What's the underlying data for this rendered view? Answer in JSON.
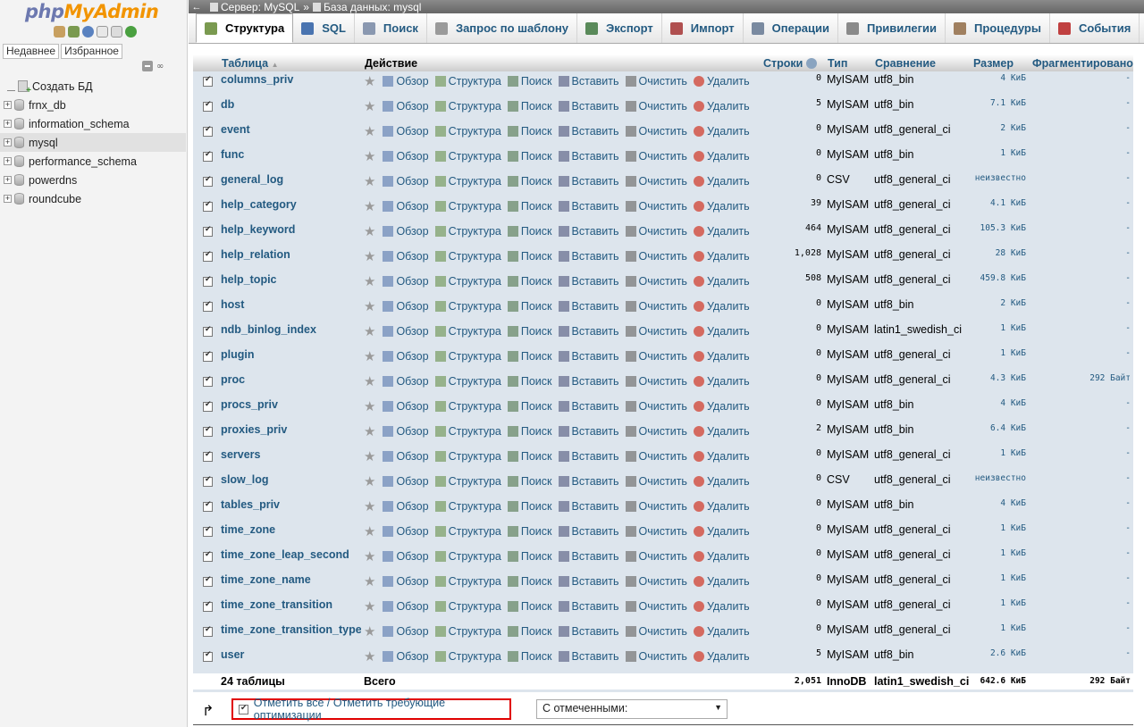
{
  "logo": {
    "php": "php",
    "myadmin": "MyAdmin"
  },
  "nav_tabs": [
    "Недавнее",
    "Избранное"
  ],
  "databases": [
    {
      "name": "Создать БД",
      "type": "new"
    },
    {
      "name": "frnx_db",
      "type": "db"
    },
    {
      "name": "information_schema",
      "type": "db"
    },
    {
      "name": "mysql",
      "type": "db",
      "active": true
    },
    {
      "name": "performance_schema",
      "type": "db"
    },
    {
      "name": "powerdns",
      "type": "db"
    },
    {
      "name": "roundcube",
      "type": "db"
    }
  ],
  "breadcrumb": {
    "server": "Сервер: MySQL",
    "sep": "»",
    "database": "База данных: mysql"
  },
  "tabs": [
    "Структура",
    "SQL",
    "Поиск",
    "Запрос по шаблону",
    "Экспорт",
    "Импорт",
    "Операции",
    "Привилегии",
    "Процедуры",
    "События",
    "Тр"
  ],
  "columns": {
    "table": "Таблица",
    "action": "Действие",
    "rows": "Строки",
    "type": "Тип",
    "collation": "Сравнение",
    "size": "Размер",
    "overhead": "Фрагментировано"
  },
  "action_labels": {
    "browse": "Обзор",
    "structure": "Структура",
    "search": "Поиск",
    "insert": "Вставить",
    "empty": "Очистить",
    "drop": "Удалить"
  },
  "tables": [
    {
      "name": "columns_priv",
      "rows": "0",
      "type": "MyISAM",
      "collation": "utf8_bin",
      "size": "4 КиБ",
      "overhead": "-"
    },
    {
      "name": "db",
      "rows": "5",
      "type": "MyISAM",
      "collation": "utf8_bin",
      "size": "7.1 КиБ",
      "overhead": "-"
    },
    {
      "name": "event",
      "rows": "0",
      "type": "MyISAM",
      "collation": "utf8_general_ci",
      "size": "2 КиБ",
      "overhead": "-"
    },
    {
      "name": "func",
      "rows": "0",
      "type": "MyISAM",
      "collation": "utf8_bin",
      "size": "1 КиБ",
      "overhead": "-"
    },
    {
      "name": "general_log",
      "rows": "0",
      "type": "CSV",
      "collation": "utf8_general_ci",
      "size": "неизвестно",
      "overhead": "-"
    },
    {
      "name": "help_category",
      "rows": "39",
      "type": "MyISAM",
      "collation": "utf8_general_ci",
      "size": "4.1 КиБ",
      "overhead": "-"
    },
    {
      "name": "help_keyword",
      "rows": "464",
      "type": "MyISAM",
      "collation": "utf8_general_ci",
      "size": "105.3 КиБ",
      "overhead": "-"
    },
    {
      "name": "help_relation",
      "rows": "1,028",
      "type": "MyISAM",
      "collation": "utf8_general_ci",
      "size": "28 КиБ",
      "overhead": "-"
    },
    {
      "name": "help_topic",
      "rows": "508",
      "type": "MyISAM",
      "collation": "utf8_general_ci",
      "size": "459.8 КиБ",
      "overhead": "-"
    },
    {
      "name": "host",
      "rows": "0",
      "type": "MyISAM",
      "collation": "utf8_bin",
      "size": "2 КиБ",
      "overhead": "-"
    },
    {
      "name": "ndb_binlog_index",
      "rows": "0",
      "type": "MyISAM",
      "collation": "latin1_swedish_ci",
      "size": "1 КиБ",
      "overhead": "-"
    },
    {
      "name": "plugin",
      "rows": "0",
      "type": "MyISAM",
      "collation": "utf8_general_ci",
      "size": "1 КиБ",
      "overhead": "-"
    },
    {
      "name": "proc",
      "rows": "0",
      "type": "MyISAM",
      "collation": "utf8_general_ci",
      "size": "4.3 КиБ",
      "overhead": "292 Байт"
    },
    {
      "name": "procs_priv",
      "rows": "0",
      "type": "MyISAM",
      "collation": "utf8_bin",
      "size": "4 КиБ",
      "overhead": "-"
    },
    {
      "name": "proxies_priv",
      "rows": "2",
      "type": "MyISAM",
      "collation": "utf8_bin",
      "size": "6.4 КиБ",
      "overhead": "-"
    },
    {
      "name": "servers",
      "rows": "0",
      "type": "MyISAM",
      "collation": "utf8_general_ci",
      "size": "1 КиБ",
      "overhead": "-"
    },
    {
      "name": "slow_log",
      "rows": "0",
      "type": "CSV",
      "collation": "utf8_general_ci",
      "size": "неизвестно",
      "overhead": "-"
    },
    {
      "name": "tables_priv",
      "rows": "0",
      "type": "MyISAM",
      "collation": "utf8_bin",
      "size": "4 КиБ",
      "overhead": "-"
    },
    {
      "name": "time_zone",
      "rows": "0",
      "type": "MyISAM",
      "collation": "utf8_general_ci",
      "size": "1 КиБ",
      "overhead": "-"
    },
    {
      "name": "time_zone_leap_second",
      "rows": "0",
      "type": "MyISAM",
      "collation": "utf8_general_ci",
      "size": "1 КиБ",
      "overhead": "-"
    },
    {
      "name": "time_zone_name",
      "rows": "0",
      "type": "MyISAM",
      "collation": "utf8_general_ci",
      "size": "1 КиБ",
      "overhead": "-"
    },
    {
      "name": "time_zone_transition",
      "rows": "0",
      "type": "MyISAM",
      "collation": "utf8_general_ci",
      "size": "1 КиБ",
      "overhead": "-"
    },
    {
      "name": "time_zone_transition_type",
      "rows": "0",
      "type": "MyISAM",
      "collation": "utf8_general_ci",
      "size": "1 КиБ",
      "overhead": "-"
    },
    {
      "name": "user",
      "rows": "5",
      "type": "MyISAM",
      "collation": "utf8_bin",
      "size": "2.6 КиБ",
      "overhead": "-"
    }
  ],
  "total": {
    "count": "24 таблицы",
    "label": "Всего",
    "rows": "2,051",
    "type": "InnoDB",
    "collation": "latin1_swedish_ci",
    "size": "642.6 КиБ",
    "overhead": "292 Байт"
  },
  "footer": {
    "check_all": "Отметить все / Отметить требующие оптимизации",
    "with_selected": "С отмеченными:"
  },
  "colors": {
    "link": "#235a81",
    "row_bg": "#dde5ed",
    "highlight_border": "#e00000",
    "logo_php": "#6c78af",
    "logo_myadmin": "#f29400"
  }
}
